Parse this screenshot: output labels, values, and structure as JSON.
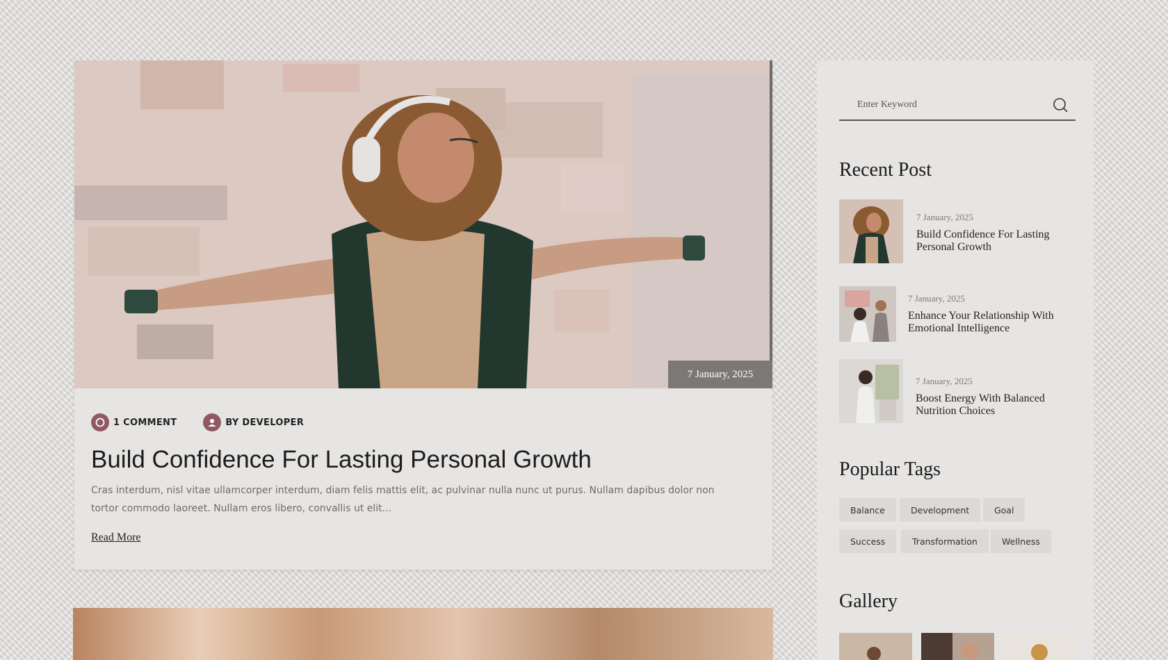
{
  "post": {
    "date_badge": "7 January, 2025",
    "comments": "1 COMMENT",
    "author": "BY DEVELOPER",
    "title": "Build Confidence For Lasting Personal Growth",
    "excerpt": "Cras interdum, nisl vitae ullamcorper interdum, diam felis mattis elit, ac pulvinar nulla nunc ut purus. Nullam dapibus dolor non tortor commodo laoreet. Nullam eros libero, convallis ut elit...",
    "read_more": "Read More"
  },
  "search": {
    "placeholder": "Enter Keyword",
    "icon": "search-icon"
  },
  "recent": {
    "heading": "Recent Post",
    "items": [
      {
        "date": "7 January, 2025",
        "title": "Build Confidence For Lasting Personal Growth"
      },
      {
        "date": "7 January, 2025",
        "title": "Enhance Your Relationship With Emotional Intelligence"
      },
      {
        "date": "7 January, 2025",
        "title": "Boost Energy With Balanced Nutrition Choices"
      }
    ]
  },
  "tags": {
    "heading": "Popular Tags",
    "items": [
      "Balance",
      "Development",
      "Goal",
      "Success",
      "Transformation",
      "Wellness"
    ]
  },
  "gallery": {
    "heading": "Gallery"
  },
  "colors": {
    "accent": "#8e5a60",
    "badge_bg": "#7c7876",
    "card_bg": "#e7e5e3",
    "tag_bg": "#dcdad8"
  }
}
